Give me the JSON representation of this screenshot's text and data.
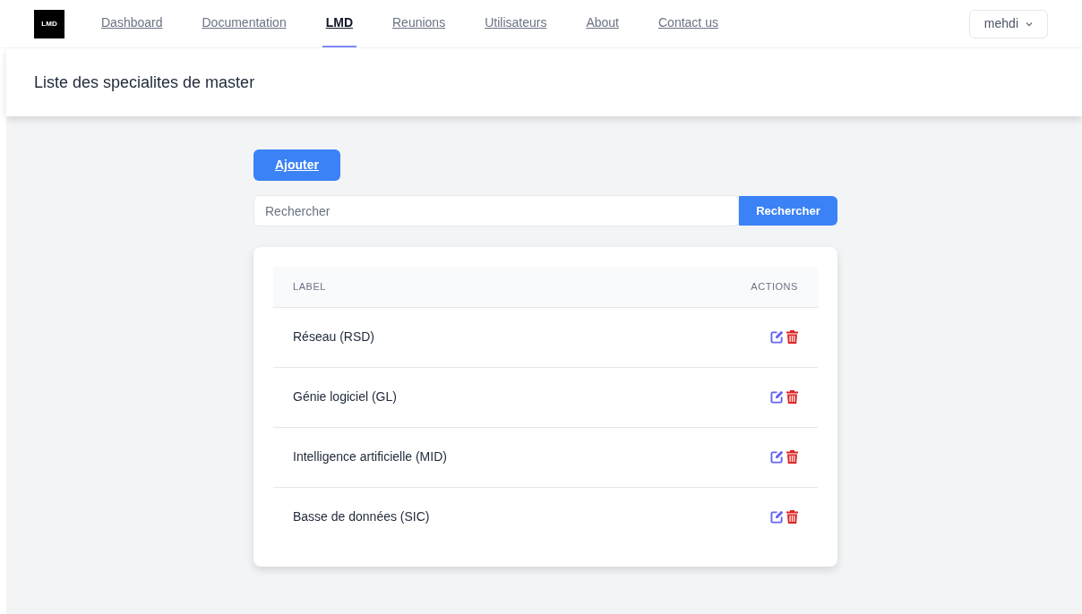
{
  "navbar": {
    "logo_text": "LMD",
    "links": [
      {
        "label": "Dashboard",
        "selected": false
      },
      {
        "label": "Documentation",
        "selected": false
      },
      {
        "label": "LMD",
        "selected": true
      },
      {
        "label": "Reunions",
        "selected": false
      },
      {
        "label": "Utilisateurs",
        "selected": false
      },
      {
        "label": "About",
        "selected": false
      },
      {
        "label": "Contact us",
        "selected": false
      }
    ],
    "user_menu": {
      "label": "mehdi"
    }
  },
  "page_title": "Liste des specialites de master",
  "add_button": "Ajouter",
  "search": {
    "placeholder": "Rechercher",
    "button": "Rechercher"
  },
  "table": {
    "columns": [
      "LABEL",
      "ACTIONS"
    ],
    "rows": [
      {
        "label": "Réseau (RSD)"
      },
      {
        "label": "Génie logiciel (GL)"
      },
      {
        "label": "Intelligence artificielle (MID)"
      },
      {
        "label": "Basse de données (SIC)"
      }
    ]
  }
}
